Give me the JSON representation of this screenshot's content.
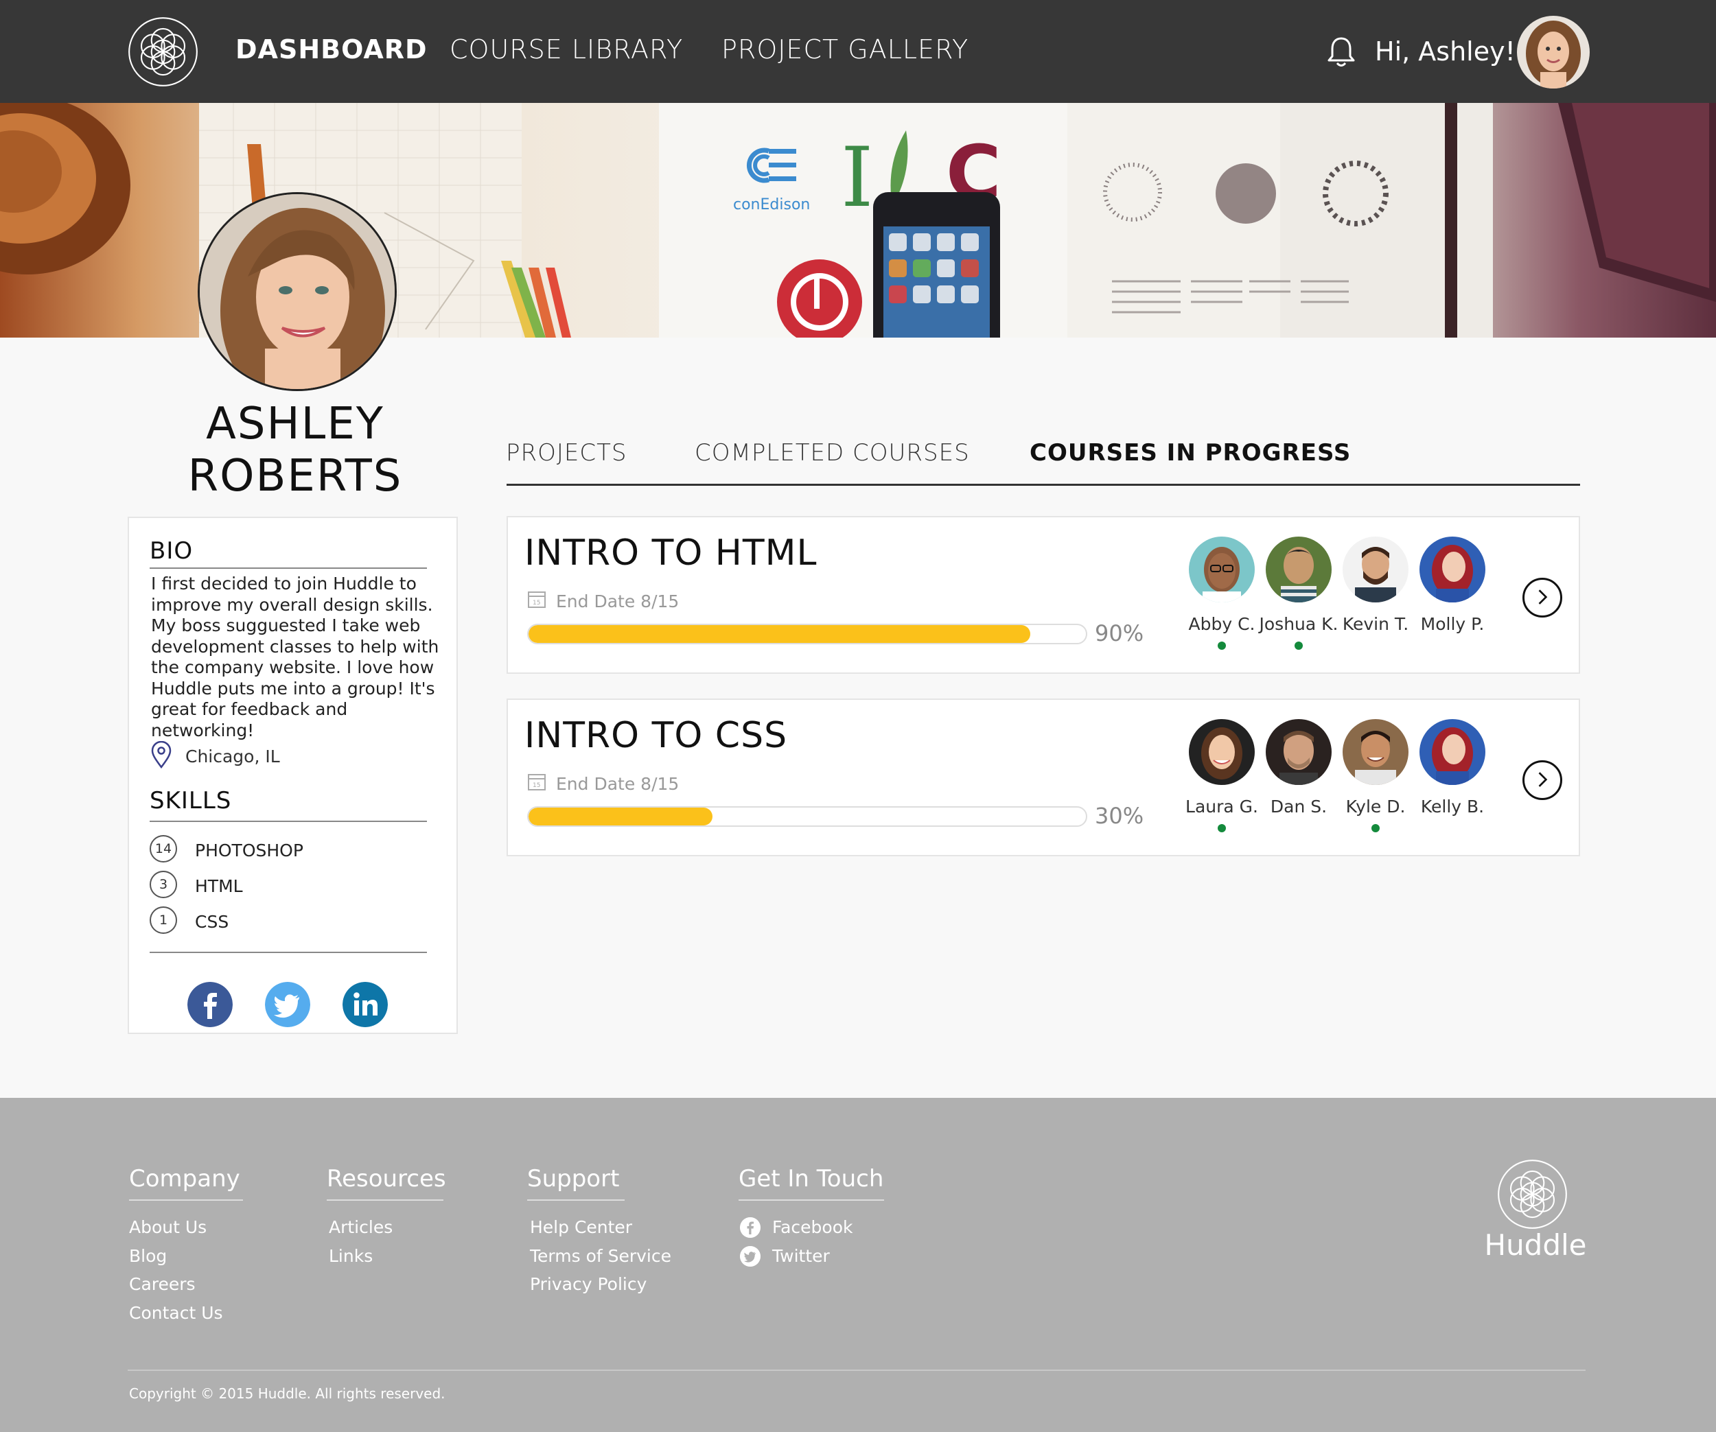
{
  "nav": {
    "links": [
      "DASHBOARD",
      "COURSE LIBRARY",
      "PROJECT GALLERY"
    ],
    "greeting": "Hi, Ashley!"
  },
  "hero": {
    "brand_logo": "conEdison"
  },
  "profile": {
    "first_name": "ASHLEY",
    "last_name": "ROBERTS",
    "bio_heading": "BIO",
    "bio_lines": [
      "I first decided to join Huddle to",
      "improve my overall design skills.",
      "My boss sugguested I take web",
      "development classes to help with",
      "the company website. I love how",
      "Huddle puts me into a group! It's",
      "great for feedback and networking!"
    ],
    "location": "Chicago, IL",
    "skills_heading": "SKILLS",
    "skills": [
      {
        "count": "14",
        "name": "PHOTOSHOP"
      },
      {
        "count": "3",
        "name": "HTML"
      },
      {
        "count": "1",
        "name": "CSS"
      }
    ],
    "social_icons": [
      "facebook-icon",
      "twitter-icon",
      "linkedin-icon"
    ]
  },
  "tabs": [
    "PROJECTS",
    "COMPLETED COURSES",
    "COURSES IN PROGRESS"
  ],
  "courses": [
    {
      "title": "INTRO TO HTML",
      "end_date": "End Date 8/15",
      "calendar_day": "15",
      "progress": 0.9,
      "progress_label": "90%",
      "members": [
        {
          "name": "Abby C.",
          "online": true
        },
        {
          "name": "Joshua K.",
          "online": true
        },
        {
          "name": "Kevin T.",
          "online": false
        },
        {
          "name": "Molly P.",
          "online": false
        }
      ]
    },
    {
      "title": "INTRO TO CSS",
      "end_date": "End Date 8/15",
      "calendar_day": "15",
      "progress": 0.33,
      "progress_label": "30%",
      "members": [
        {
          "name": "Laura G.",
          "online": true
        },
        {
          "name": "Dan S.",
          "online": false
        },
        {
          "name": "Kyle D.",
          "online": true
        },
        {
          "name": "Kelly B.",
          "online": false
        }
      ]
    }
  ],
  "footer": {
    "columns": [
      {
        "heading": "Company",
        "links": [
          "About Us",
          "Blog",
          "Careers",
          "Contact Us"
        ]
      },
      {
        "heading": "Resources",
        "links": [
          "Articles",
          "Links"
        ]
      },
      {
        "heading": "Support",
        "links": [
          "Help Center",
          "Terms of Service",
          "Privacy Policy"
        ]
      },
      {
        "heading": "Get In Touch",
        "links": [
          "Facebook",
          "Twitter"
        ]
      }
    ],
    "brand": "Huddle",
    "copyright": "Copyright © 2015 Huddle. All rights reserved."
  },
  "colors": {
    "nav_bg": "#373737",
    "progress": "#fbc11a",
    "online": "#148a3c",
    "footer_bg": "#b0b0b0",
    "facebook": "#3b5998",
    "twitter": "#55acee",
    "linkedin": "#0e76a8"
  }
}
